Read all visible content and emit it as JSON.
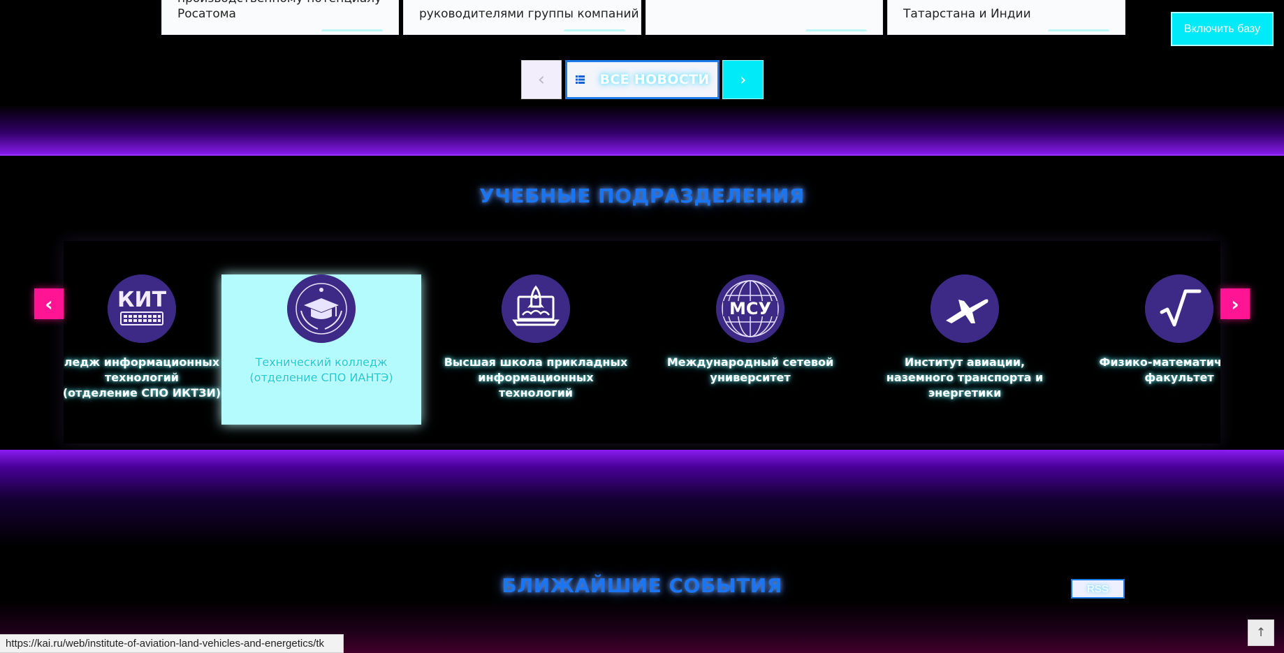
{
  "news": {
    "cards": [
      {
        "title": "производственному потенциалу\nРосатома"
      },
      {
        "title": "руководителями группы компаний"
      },
      {
        "title": ""
      },
      {
        "title": "Татарстана и Индии"
      }
    ],
    "pager": {
      "all_label": "ВСЕ НОВОСТИ",
      "prev_symbol": "‹",
      "next_symbol": "›"
    }
  },
  "accessibility": {
    "enable_base_label": "Включить базу"
  },
  "units_section": {
    "title": "УЧЕБНЫЕ ПОДРАЗДЕЛЕНИЯ",
    "prev_symbol": "‹",
    "next_symbol": "›",
    "items": [
      {
        "logo": "kit-logo-icon",
        "logo_text": "КИТ",
        "lines": [
          "ледж информационных",
          "технологий",
          "(отделение СПО ИКТЗИ)"
        ],
        "active": false
      },
      {
        "logo": "graduation-cap-emblem-icon",
        "logo_text": "",
        "lines": [
          "Технический колледж",
          "(отделение СПО ИАНТЭ)"
        ],
        "active": true
      },
      {
        "logo": "laptop-rocket-icon",
        "logo_text": "",
        "lines": [
          "Высшая школа прикладных",
          "информационных",
          "технологий"
        ],
        "active": false
      },
      {
        "logo": "msu-globe-icon",
        "logo_text": "МСУ",
        "lines": [
          "Международный сетевой",
          "университет"
        ],
        "active": false
      },
      {
        "logo": "airplane-icon",
        "logo_text": "",
        "lines": [
          "Институт авиации,",
          "наземного транспорта и",
          "энергетики"
        ],
        "active": false
      },
      {
        "logo": "square-root-icon",
        "logo_text": "√",
        "lines": [
          "Физико-математический",
          "факультет"
        ],
        "active": false
      }
    ]
  },
  "events_section": {
    "title": "БЛИЖАЙШИЕ СОБЫТИЯ",
    "rss_label": "RSS"
  },
  "scroll_top": {
    "symbol": "↑"
  },
  "statusbar": {
    "url": "https://kai.ru/web/institute-of-aviation-land-vehicles-and-energetics/tk"
  },
  "colors": {
    "accent_cyan": "#00eaf8",
    "accent_blue": "#1b74f0",
    "accent_pink": "#ff1493",
    "accent_purple": "#8a1cf0",
    "logo_bg": "#3d2a86",
    "active_card_bg": "#b4fbfd"
  }
}
